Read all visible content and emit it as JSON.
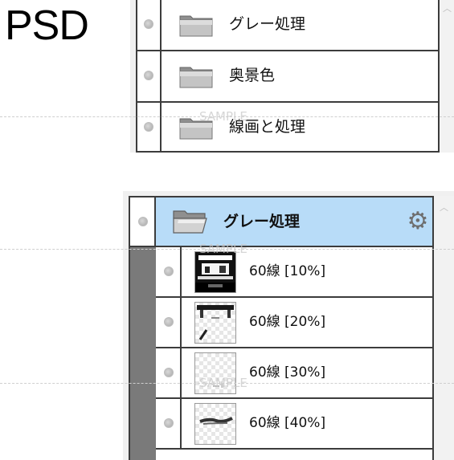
{
  "label": "PSD",
  "watermark": "SAMPLE",
  "panel1": {
    "rows": [
      {
        "name": "グレー処理",
        "icon": "folder-icon"
      },
      {
        "name": "奥景色",
        "icon": "folder-icon"
      },
      {
        "name": "線画と処理",
        "icon": "folder-icon"
      }
    ]
  },
  "panel2": {
    "folder": {
      "name": "グレー処理",
      "icon": "folder-open-icon",
      "settings_icon": "gear-icon",
      "highlight": "#b8dcf8"
    },
    "layers": [
      {
        "name": "60線 [10%]",
        "thumb": "dark-scene"
      },
      {
        "name": "60線 [20%]",
        "thumb": "sparse-sketch"
      },
      {
        "name": "60線 [30%]",
        "thumb": "transparent-faint"
      },
      {
        "name": "60線 [40%]",
        "thumb": "brush-stroke"
      }
    ]
  },
  "colors": {
    "border": "#3c3c3c",
    "selected_folder": "#b8dcf8",
    "indent_bar": "#7a7a7a"
  }
}
